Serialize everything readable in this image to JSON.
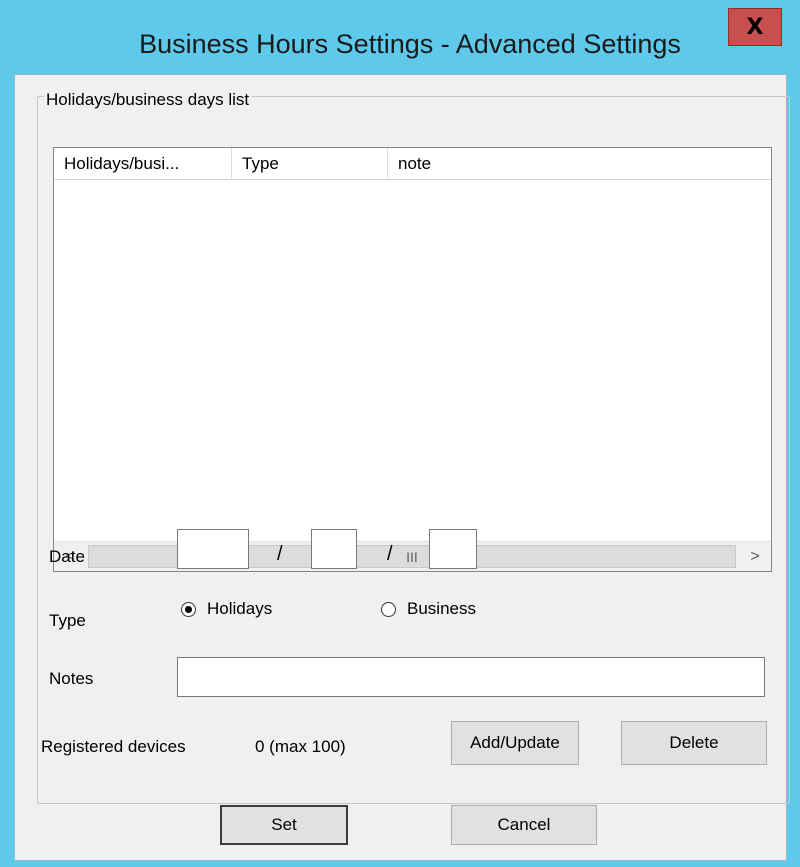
{
  "window": {
    "title": "Business Hours Settings - Advanced Settings",
    "close_glyph": "X"
  },
  "group": {
    "legend": "Holidays/business days list"
  },
  "list": {
    "columns": [
      "Holidays/busi...",
      "Type",
      "note"
    ],
    "rows": [],
    "scroll_left_icon": "<",
    "scroll_right_icon": ">",
    "thumb_grip": "III"
  },
  "form": {
    "date_label": "Date",
    "date_separator": "/",
    "date_year": "",
    "date_month": "",
    "date_day": "",
    "type_label": "Type",
    "type_options": [
      {
        "label": "Holidays",
        "selected": true
      },
      {
        "label": "Business",
        "selected": false
      }
    ],
    "notes_label": "Notes",
    "notes_value": "",
    "registered_label": "Registered devices",
    "registered_value": "0 (max 100)",
    "add_update_label": "Add/Update",
    "delete_label": "Delete"
  },
  "footer": {
    "set_label": "Set",
    "cancel_label": "Cancel"
  },
  "colors": {
    "title_bar": "#5fc9ec",
    "close_button": "#c7504e",
    "dialog_bg": "#f0f0f0"
  }
}
